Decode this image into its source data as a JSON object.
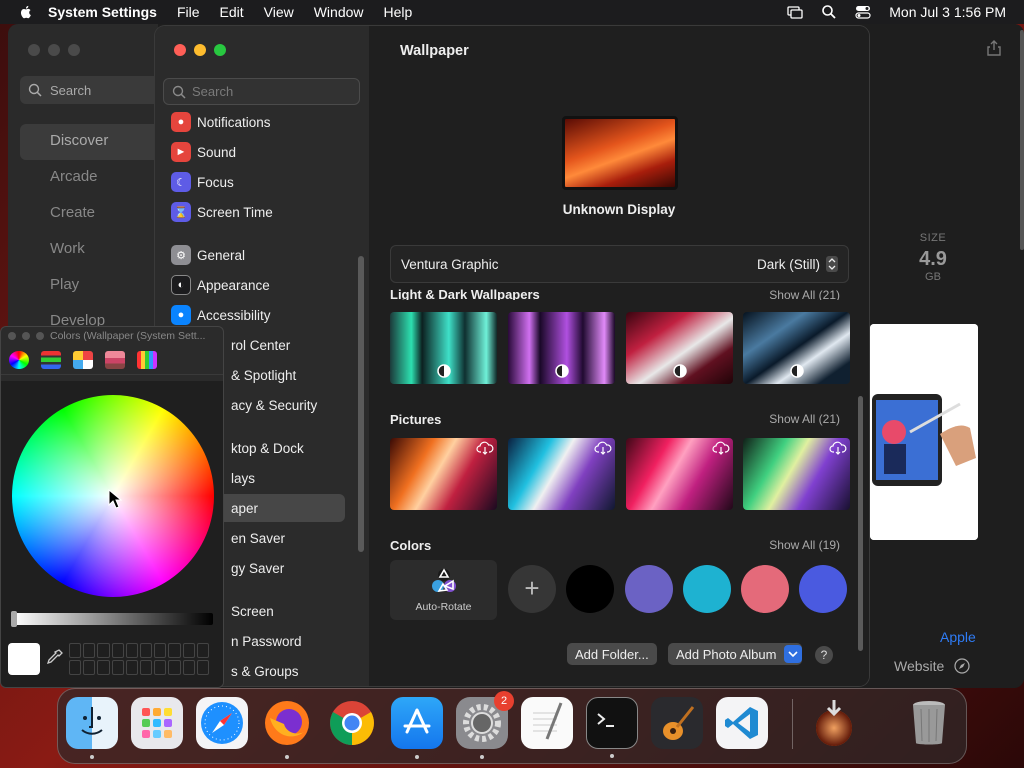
{
  "menubar": {
    "app": "System Settings",
    "items": [
      "File",
      "Edit",
      "View",
      "Window",
      "Help"
    ],
    "clock": "Mon Jul 3  1:56 PM"
  },
  "appstore": {
    "search_placeholder": "Search",
    "nav": [
      "Discover",
      "Arcade",
      "Create",
      "Work",
      "Play",
      "Develop"
    ],
    "size_label": "SIZE",
    "size_value": "4.9",
    "size_unit": "GB",
    "developer_link": "Apple",
    "website_link": "Website"
  },
  "settings": {
    "search_placeholder": "Search",
    "sidebar": [
      {
        "label": "Notifications",
        "icon": "bell-icon",
        "color": "#e5453d"
      },
      {
        "label": "Sound",
        "icon": "speaker-icon",
        "color": "#e5453d"
      },
      {
        "label": "Focus",
        "icon": "moon-icon",
        "color": "#5e5ce6"
      },
      {
        "label": "Screen Time",
        "icon": "hourglass-icon",
        "color": "#5e5ce6"
      },
      {
        "label": "General",
        "icon": "gear-icon",
        "color": "#8e8e93"
      },
      {
        "label": "Appearance",
        "icon": "appearance-icon",
        "color": "#1c1c1e"
      },
      {
        "label": "Accessibility",
        "icon": "accessibility-icon",
        "color": "#0a84ff"
      },
      {
        "label": "rol Center",
        "icon": "",
        "color": ""
      },
      {
        "label": "& Spotlight",
        "icon": "",
        "color": ""
      },
      {
        "label": "acy & Security",
        "icon": "",
        "color": ""
      },
      {
        "label": "ktop & Dock",
        "icon": "",
        "color": ""
      },
      {
        "label": "lays",
        "icon": "",
        "color": ""
      },
      {
        "label": "aper",
        "icon": "",
        "color": ""
      },
      {
        "label": "en Saver",
        "icon": "",
        "color": ""
      },
      {
        "label": "gy Saver",
        "icon": "",
        "color": ""
      },
      {
        "label": "Screen",
        "icon": "",
        "color": ""
      },
      {
        "label": "n Password",
        "icon": "",
        "color": ""
      },
      {
        "label": "s & Groups",
        "icon": "",
        "color": ""
      }
    ],
    "title": "Wallpaper",
    "display_name": "Unknown Display",
    "picker_name": "Ventura Graphic",
    "picker_value": "Dark (Still)",
    "sections": {
      "light_dark": {
        "title": "Light & Dark Wallpapers",
        "show_all": "Show All (21)"
      },
      "pictures": {
        "title": "Pictures",
        "show_all": "Show All (21)"
      },
      "colors": {
        "title": "Colors",
        "show_all": "Show All (19)"
      }
    },
    "auto_rotate": "Auto-Rotate",
    "color_swatches": [
      "#000000",
      "#6b62c4",
      "#1eb2d1",
      "#e46a7a",
      "#4a5ae0"
    ],
    "buttons": {
      "add_folder": "Add Folder...",
      "add_album": "Add Photo Album",
      "help": "?"
    }
  },
  "colors_panel": {
    "title": "Colors (Wallpaper (System Sett..."
  },
  "dock": {
    "apps": [
      "Finder",
      "Launchpad",
      "Safari",
      "Firefox",
      "Chrome",
      "App Store",
      "System Settings",
      "TextEdit",
      "Terminal",
      "GarageBand",
      "Visual Studio Code",
      "Downloads",
      "Trash"
    ],
    "settings_badge": "2"
  }
}
